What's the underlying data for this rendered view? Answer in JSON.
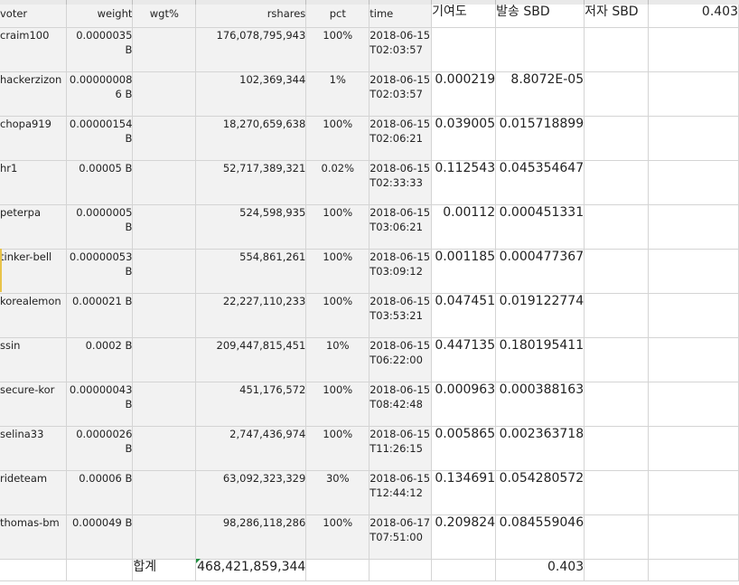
{
  "header": {
    "voter": "voter",
    "weight": "weight",
    "wgt_pct": "wgt%",
    "rshares": "rshares",
    "pct": "pct",
    "time": "time",
    "contribution": "기여도",
    "sent_sbd": "발송 SBD",
    "author_sbd": "저자 SBD",
    "author_sbd_value": "0.403"
  },
  "rows": [
    {
      "voter": "craim100",
      "weight": "0.0000035 B",
      "rshares": "176,078,795,943",
      "pct": "100%",
      "time": "2018-06-15T02:03:57",
      "contribution": "",
      "sent_sbd": ""
    },
    {
      "voter": "hackerzizon",
      "weight": "0.00000008 6 B",
      "rshares": "102,369,344",
      "pct": "1%",
      "time": "2018-06-15T02:03:57",
      "contribution": "0.000219",
      "sent_sbd": "8.8072E-05"
    },
    {
      "voter": "chopa919",
      "weight": "0.00000154 B",
      "rshares": "18,270,659,638",
      "pct": "100%",
      "time": "2018-06-15T02:06:21",
      "contribution": "0.039005",
      "sent_sbd": "0.015718899"
    },
    {
      "voter": "hr1",
      "weight": "0.00005 B",
      "rshares": "52,717,389,321",
      "pct": "0.02%",
      "time": "2018-06-15T02:33:33",
      "contribution": "0.112543",
      "sent_sbd": "0.045354647"
    },
    {
      "voter": "peterpa",
      "weight": "0.0000005 B",
      "rshares": "524,598,935",
      "pct": "100%",
      "time": "2018-06-15T03:06:21",
      "contribution": "0.00112",
      "sent_sbd": "0.000451331"
    },
    {
      "voter": "tinker-bell",
      "weight": "0.00000053 B",
      "rshares": "554,861,261",
      "pct": "100%",
      "time": "2018-06-15T03:09:12",
      "contribution": "0.001185",
      "sent_sbd": "0.000477367"
    },
    {
      "voter": "korealemon",
      "weight": "0.000021 B",
      "rshares": "22,227,110,233",
      "pct": "100%",
      "time": "2018-06-15T03:53:21",
      "contribution": "0.047451",
      "sent_sbd": "0.019122774"
    },
    {
      "voter": "ssin",
      "weight": "0.0002 B",
      "rshares": "209,447,815,451",
      "pct": "10%",
      "time": "2018-06-15T06:22:00",
      "contribution": "0.447135",
      "sent_sbd": "0.180195411"
    },
    {
      "voter": "secure-kor",
      "weight": "0.00000043 B",
      "rshares": "451,176,572",
      "pct": "100%",
      "time": "2018-06-15T08:42:48",
      "contribution": "0.000963",
      "sent_sbd": "0.000388163"
    },
    {
      "voter": "selina33",
      "weight": "0.0000026 B",
      "rshares": "2,747,436,974",
      "pct": "100%",
      "time": "2018-06-15T11:26:15",
      "contribution": "0.005865",
      "sent_sbd": "0.002363718"
    },
    {
      "voter": "rideteam",
      "weight": "0.00006 B",
      "rshares": "63,092,323,329",
      "pct": "30%",
      "time": "2018-06-15T12:44:12",
      "contribution": "0.134691",
      "sent_sbd": "0.054280572"
    },
    {
      "voter": "thomas-bm",
      "weight": "0.000049 B",
      "rshares": "98,286,118,286",
      "pct": "100%",
      "time": "2018-06-17T07:51:00",
      "contribution": "0.209824",
      "sent_sbd": "0.084559046"
    }
  ],
  "summary": {
    "label": "합계",
    "rshares_total": "468,421,859,344",
    "sbd_total": "0.403"
  }
}
